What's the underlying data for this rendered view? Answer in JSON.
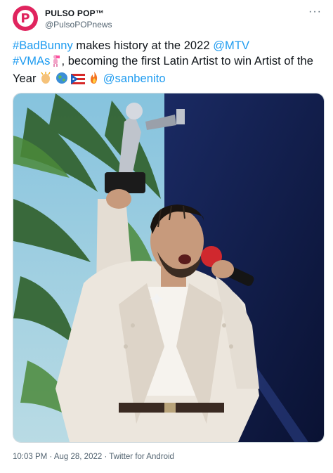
{
  "author": {
    "display_name": "PULSO POP™",
    "handle": "@PulsoPOPnews",
    "avatar_letter": "P"
  },
  "menu": {
    "more_label": "···"
  },
  "tweet": {
    "hashtag_1": "#BadBunny",
    "text_1": " makes history at the 2022 ",
    "mention_1": "@MTV",
    "hashtag_2": "#VMAs",
    "text_2": ", becoming the first Latin Artist to win Artist of the Year ",
    "mention_2": "@sanbenito"
  },
  "media": {
    "description_icons": [
      "trophy",
      "microphone",
      "person-in-white-suit"
    ]
  },
  "meta": {
    "time": "10:03 PM",
    "separator_1": " · ",
    "date": "Aug 28, 2022",
    "separator_2": " · ",
    "source": "Twitter for Android"
  },
  "colors": {
    "brand_pink": "#e0245e",
    "link_blue": "#1d9bf0",
    "secondary_text": "#536471"
  }
}
